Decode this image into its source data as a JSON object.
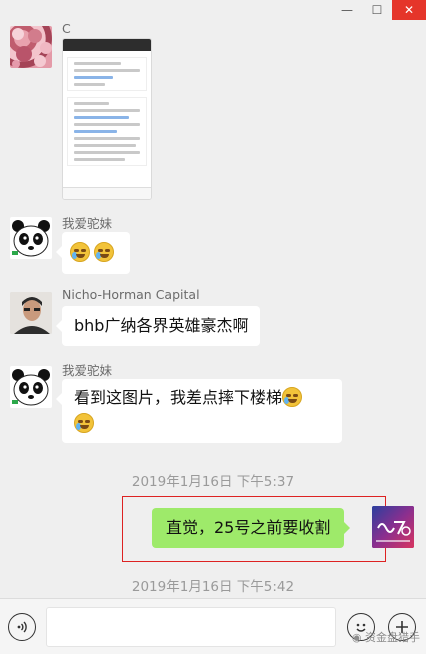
{
  "window": {
    "minimize_glyph": "—",
    "maximize_glyph": "☐",
    "close_glyph": "✕"
  },
  "messages": [
    {
      "sender": "C",
      "type": "image"
    },
    {
      "sender": "我爱驼妹",
      "type": "emoji",
      "emoji": [
        "laugh-cry",
        "laugh-cry"
      ]
    },
    {
      "sender": "Nicho-Horman Capital",
      "text": "bhb广纳各界英雄豪杰啊"
    },
    {
      "sender": "我爱驼妹",
      "text": "看到这图片，我差点摔下楼梯"
    },
    {
      "sender": "me",
      "text": "直觉，25号之前要收割"
    }
  ],
  "timestamps": [
    "2019年1月16日 下午5:37",
    "2019年1月16日 下午5:42"
  ],
  "input_bar": {
    "voice_icon": "voice-icon",
    "emoji_icon": "emoji-icon",
    "plus_icon": "plus-icon",
    "watermark": "资金盘猎手"
  },
  "colors": {
    "bubble_self": "#9eea6a",
    "bubble_other": "#ffffff",
    "highlight_border": "#dd2222",
    "close_button": "#e5352a"
  }
}
